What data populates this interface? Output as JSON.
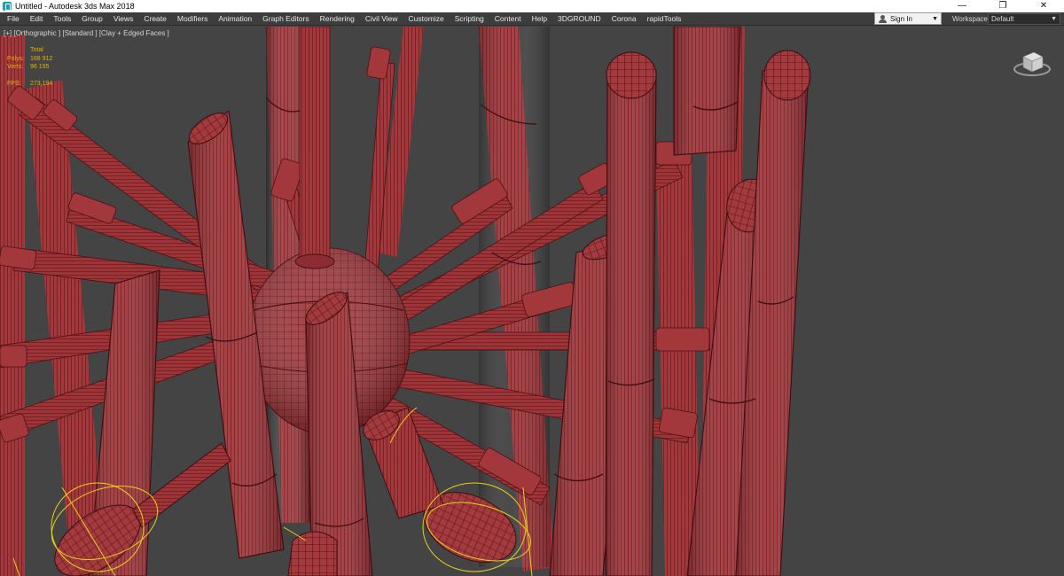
{
  "window": {
    "title": "Untitled - Autodesk 3ds Max 2018",
    "icon": "3dsmax-app-icon",
    "controls": [
      "minimize-icon",
      "restore-icon",
      "close-icon"
    ]
  },
  "menu": {
    "items": [
      "File",
      "Edit",
      "Tools",
      "Group",
      "Views",
      "Create",
      "Modifiers",
      "Animation",
      "Graph Editors",
      "Rendering",
      "Civil View",
      "Customize",
      "Scripting",
      "Content",
      "Help",
      "3DGROUND",
      "Corona",
      "rapidTools"
    ],
    "sign_in": "Sign In",
    "workspaces_label": "Workspaces:",
    "workspaces_value": "Default"
  },
  "viewport": {
    "label": "[+] [Orthographic ] [Standard ] [Clay + Edged Faces ]",
    "stats": {
      "header": "Total",
      "polys_label": "Polys:",
      "polys_value": "168 912",
      "verts_label": "Verts:",
      "verts_value": "96 195",
      "fps_label": "FPS:",
      "fps_value": "273,194"
    },
    "colors": {
      "background": "#444444",
      "mesh": "#a3383c",
      "mesh_dark": "#6e1d21",
      "wire": "#4a1114",
      "stats_text": "#e0b400",
      "selection_gizmo": "#e8d31a"
    }
  }
}
